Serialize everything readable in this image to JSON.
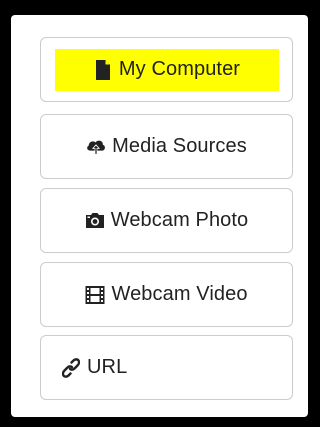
{
  "menu": {
    "items": [
      {
        "label": "My Computer",
        "icon": "file-icon",
        "highlight_color": "#ffff00"
      },
      {
        "label": "Media Sources",
        "icon": "cloud-upload-icon"
      },
      {
        "label": "Webcam Photo",
        "icon": "camera-icon"
      },
      {
        "label": "Webcam Video",
        "icon": "film-icon"
      },
      {
        "label": "URL",
        "icon": "link-icon"
      }
    ]
  }
}
